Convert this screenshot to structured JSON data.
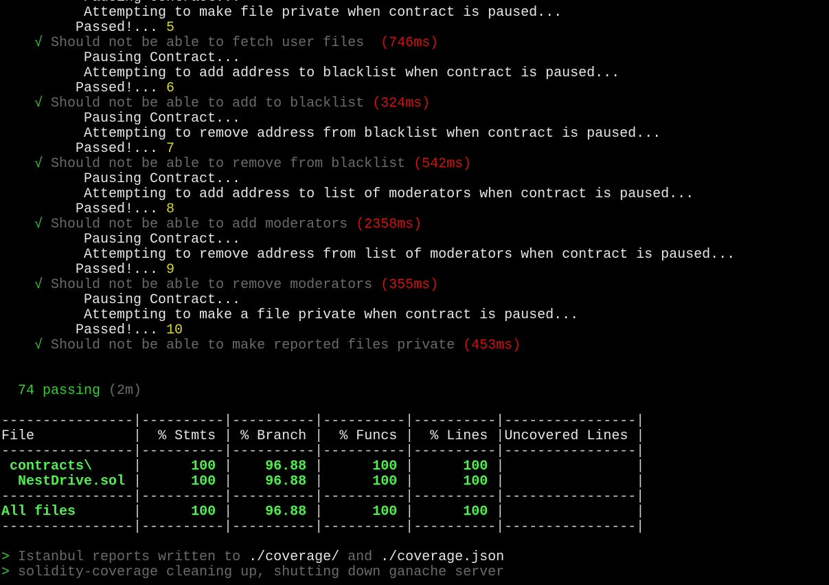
{
  "colors": {
    "text": "#e6e6e6",
    "dim": "#6b6b6b",
    "check": "#2fd02f",
    "duration": "#d40d0d",
    "counter": "#d8d820",
    "coverage": "#4cf04c"
  },
  "log_lines": [
    [
      {
        "t": "          Pausing Contract...",
        "c": "w"
      }
    ],
    [
      {
        "t": "          Attempting to make file private when contract is paused...",
        "c": "w"
      }
    ],
    [
      {
        "t": "         Passed!... ",
        "c": "w"
      },
      {
        "t": "5",
        "c": "y"
      }
    ],
    [
      {
        "t": "    √ ",
        "c": "ck"
      },
      {
        "t": "Should not be able to fetch user files  ",
        "c": "g"
      },
      {
        "t": "(746ms)",
        "c": "r"
      }
    ],
    [
      {
        "t": "          Pausing Contract...",
        "c": "w"
      }
    ],
    [
      {
        "t": "          Attempting to add address to blacklist when contract is paused...",
        "c": "w"
      }
    ],
    [
      {
        "t": "         Passed!... ",
        "c": "w"
      },
      {
        "t": "6",
        "c": "y"
      }
    ],
    [
      {
        "t": "    √ ",
        "c": "ck"
      },
      {
        "t": "Should not be able to add to blacklist ",
        "c": "g"
      },
      {
        "t": "(324ms)",
        "c": "r"
      }
    ],
    [
      {
        "t": "          Pausing Contract...",
        "c": "w"
      }
    ],
    [
      {
        "t": "          Attempting to remove address from blacklist when contract is paused...",
        "c": "w"
      }
    ],
    [
      {
        "t": "         Passed!... ",
        "c": "w"
      },
      {
        "t": "7",
        "c": "y"
      }
    ],
    [
      {
        "t": "    √ ",
        "c": "ck"
      },
      {
        "t": "Should not be able to remove from blacklist ",
        "c": "g"
      },
      {
        "t": "(542ms)",
        "c": "r"
      }
    ],
    [
      {
        "t": "          Pausing Contract...",
        "c": "w"
      }
    ],
    [
      {
        "t": "          Attempting to add address to list of moderators when contract is paused...",
        "c": "w"
      }
    ],
    [
      {
        "t": "         Passed!... ",
        "c": "w"
      },
      {
        "t": "8",
        "c": "y"
      }
    ],
    [
      {
        "t": "    √ ",
        "c": "ck"
      },
      {
        "t": "Should not be able to add moderators ",
        "c": "g"
      },
      {
        "t": "(2358ms)",
        "c": "r"
      }
    ],
    [
      {
        "t": "          Pausing Contract...",
        "c": "w"
      }
    ],
    [
      {
        "t": "          Attempting to remove address from list of moderators when contract is paused...",
        "c": "w"
      }
    ],
    [
      {
        "t": "         Passed!... ",
        "c": "w"
      },
      {
        "t": "9",
        "c": "y"
      }
    ],
    [
      {
        "t": "    √ ",
        "c": "ck"
      },
      {
        "t": "Should not be able to remove moderators ",
        "c": "g"
      },
      {
        "t": "(355ms)",
        "c": "r"
      }
    ],
    [
      {
        "t": "          Pausing Contract...",
        "c": "w"
      }
    ],
    [
      {
        "t": "          Attempting to make a file private when contract is paused...",
        "c": "w"
      }
    ],
    [
      {
        "t": "         Passed!... ",
        "c": "w"
      },
      {
        "t": "10",
        "c": "y"
      }
    ],
    [
      {
        "t": "    √ ",
        "c": "ck"
      },
      {
        "t": "Should not be able to make reported files private ",
        "c": "g"
      },
      {
        "t": "(453ms)",
        "c": "r"
      }
    ],
    [],
    [],
    [
      {
        "t": "  74 passing ",
        "c": "ck"
      },
      {
        "t": "(2m)",
        "c": "g"
      }
    ],
    []
  ],
  "coverage_table": {
    "headers": [
      "File",
      "% Stmts",
      "% Branch",
      "% Funcs",
      "% Lines",
      "Uncovered Lines"
    ],
    "groups": [
      [
        [
          "contracts\\",
          "100",
          "96.88",
          "100",
          "100",
          ""
        ],
        [
          "NestDrive.sol",
          "100",
          "96.88",
          "100",
          "100",
          ""
        ]
      ],
      [
        [
          "All files",
          "100",
          "96.88",
          "100",
          "100",
          ""
        ]
      ]
    ],
    "indents": [
      [
        1,
        2
      ],
      [
        0
      ]
    ]
  },
  "footer_lines": [
    [
      {
        "t": "> ",
        "c": "ck"
      },
      {
        "t": "Istanbul reports written to ",
        "c": "g"
      },
      {
        "t": "./coverage/",
        "c": "w"
      },
      {
        "t": " and ",
        "c": "g"
      },
      {
        "t": "./coverage.json",
        "c": "w"
      }
    ],
    [
      {
        "t": "> ",
        "c": "ck"
      },
      {
        "t": "solidity-coverage cleaning up, shutting down ganache server",
        "c": "g"
      }
    ]
  ]
}
